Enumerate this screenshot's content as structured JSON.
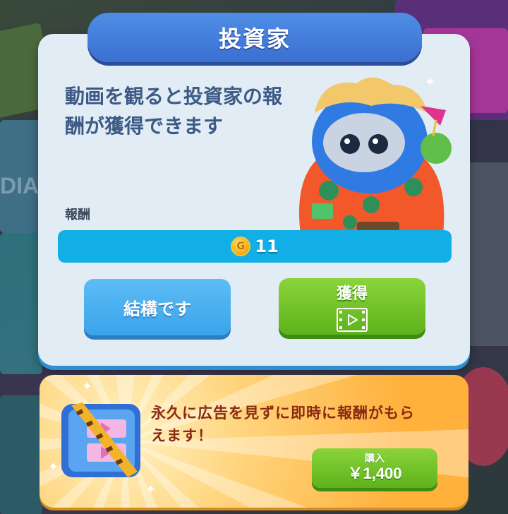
{
  "background": {
    "sign_text": "DIA"
  },
  "dialog": {
    "title": "投資家",
    "description": "動画を観ると投資家の報酬が獲得できます",
    "reward_label": "報酬",
    "reward": {
      "icon": "coin-icon",
      "coin_mark": "G",
      "amount": "11"
    },
    "buttons": {
      "decline_label": "結構です",
      "claim_label": "獲得",
      "claim_icon": "video-play-icon"
    }
  },
  "offer": {
    "text": "永久に広告を見ずに即時に報酬がもらえます！",
    "icon": "no-ads-ticket-icon",
    "buy_label": "購入",
    "price": "￥1,400"
  },
  "colors": {
    "title_bar": "#3a6fd0",
    "reward_bar": "#12aee6",
    "decline_button": "#3aa3ea",
    "claim_button": "#5db21c",
    "offer_panel": "#ffb13c",
    "offer_text": "#8a2a14"
  }
}
